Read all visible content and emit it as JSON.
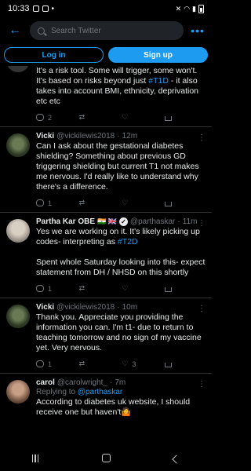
{
  "status": {
    "time": "10:33",
    "battery": ""
  },
  "search": {
    "placeholder": "Search Twitter"
  },
  "auth": {
    "login": "Log in",
    "signup": "Sign up"
  },
  "tweets": [
    {
      "partial": true,
      "text": "It's a risk tool. Some will trigger, some won't. It's based on risks beyond just ",
      "tag": "#T1D",
      "text_after": " - it also takes into account BMI, ethnicity, deprivation etc etc",
      "replies": "2",
      "retweets": "",
      "likes": ""
    },
    {
      "name": "Vicki",
      "handle": "@vickilewis2018",
      "sep": "·",
      "time": "12m",
      "text": "Can I ask about the gestational diabetes shielding? Something about previous GD triggering shielding but current T1 not makes me nervous. I'd really like to understand why there's a difference.",
      "replies": "1",
      "retweets": "",
      "likes": ""
    },
    {
      "name": "Partha Kar OBE",
      "flags": "🇮🇳 🇬🇧",
      "handle": "@parthaskar",
      "sep": "·",
      "time": "11m",
      "text1": "Yes we are working on it. It's likely picking up codes- interpreting as ",
      "tag": "#T2D",
      "text2": "Spent whole Saturday looking into this- expect statement from DH / NHSD on this shortly",
      "replies": "1",
      "retweets": "",
      "likes": ""
    },
    {
      "name": "Vicki",
      "handle": "@vickilewis2018",
      "sep": "·",
      "time": "10m",
      "text": "Thank you. Appreciate you providing the information you can. I'm t1- due to return to teaching tomorrow and no sign of my vaccine yet. Very nervous.",
      "replies": "1",
      "retweets": "",
      "likes": "3"
    },
    {
      "name": "carol",
      "handle": "@carolwright_",
      "sep": "·",
      "time": "7m",
      "reply_prefix": "Replying to ",
      "reply_to": "@parthaskar",
      "text": "According to diabetes uk website, I should receive one but haven't🤷",
      "replies": "",
      "retweets": "",
      "likes": ""
    }
  ]
}
